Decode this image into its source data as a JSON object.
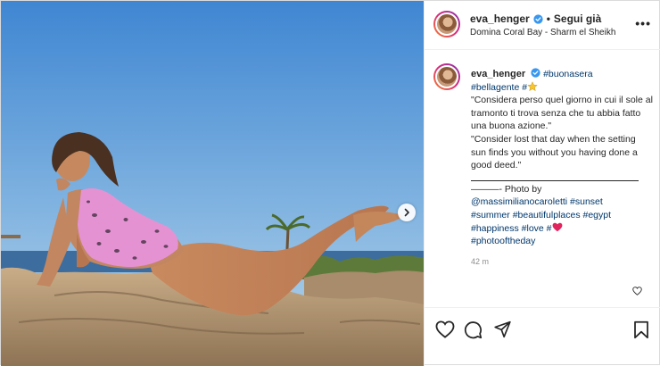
{
  "post": {
    "username": "eva_henger",
    "follow_state": "Segui già",
    "location": "Domina Coral Bay - Sharm el Sheikh",
    "caption": {
      "username": "eva_henger",
      "tags_line1": "#buonasera",
      "tags_line2": "#bellagente",
      "hash_star": "#",
      "quote_it": "\"Considera perso quel giorno in cui il sole al tramonto ti trova senza che tu abbia fatto una buona azione.\"",
      "quote_en": "\"Consider lost that day when the setting sun finds you without you having done a good deed.\"",
      "photo_by": "———- Photo by",
      "mention": "@massimilianocaroletti",
      "tag_sunset": "#sunset",
      "tag_summer": "#summer",
      "tag_places": "#beautifulplaces",
      "tag_egypt": "#egypt",
      "tag_happiness": "#happiness",
      "tag_love": "#love",
      "hash_heart": "#",
      "tag_photo": "#photooftheday"
    },
    "time": "42 m"
  },
  "icons": {
    "verified": "verified-badge-icon",
    "more": "more-options-icon",
    "like": "heart-icon",
    "comment": "comment-icon",
    "share": "share-icon",
    "save": "bookmark-icon",
    "next": "chevron-right-icon"
  },
  "colors": {
    "sky_top": "#4a8fd6",
    "sky_bottom": "#a9cbe6",
    "swimsuit": "#e58bd0",
    "link": "#00376b",
    "verified": "#3897f0"
  }
}
